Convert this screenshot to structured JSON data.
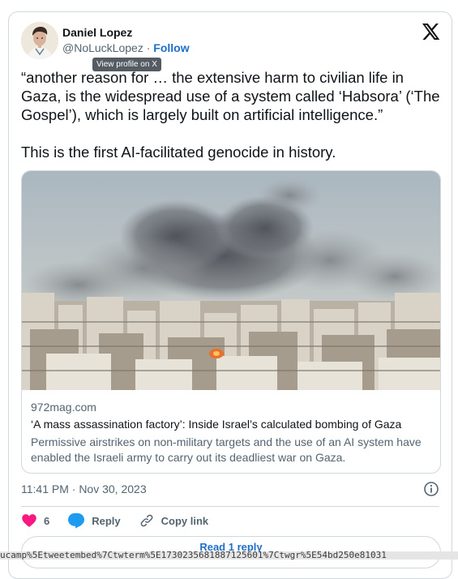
{
  "author": {
    "name": "Daniel Lopez",
    "handle": "@NoLuckLopez",
    "separator": "·",
    "follow_label": "Follow",
    "tooltip": "View profile on X"
  },
  "tweet": {
    "paragraph1": "“another reason for … the extensive harm to civilian life in Gaza, is the widespread use of a system called ‘Habsora’ (‘The Gospel’), which is largely built on artificial intelligence.”",
    "paragraph2": "This is the first AI-facilitated genocide in history."
  },
  "link_card": {
    "domain": "972mag.com",
    "title": "‘A mass assassination factory’: Inside Israel’s calculated bombing of Gaza",
    "description": "Permissive airstrikes on non-military targets and the use of an AI system have enabled the Israeli army to carry out its deadliest war on Gaza."
  },
  "meta": {
    "timestamp": "11:41 PM · Nov 30, 2023"
  },
  "actions": {
    "like_count": "6",
    "reply_label": "Reply",
    "copy_label": "Copy link"
  },
  "read_replies_label": "Read 1 reply",
  "url_fragment": "ucamp%5Etweetembed%7Ctwterm%5E1730235681887125601%7Ctwgr%5E54bd250e81031",
  "icons": {
    "logo": "x-logo-icon",
    "info": "info-icon",
    "like": "heart-icon",
    "reply": "speech-bubble-icon",
    "copy": "link-icon"
  },
  "colors": {
    "heart": "#f91880",
    "reply_bubble": "#1d9bf0",
    "link_blue": "#1d6fc9"
  }
}
